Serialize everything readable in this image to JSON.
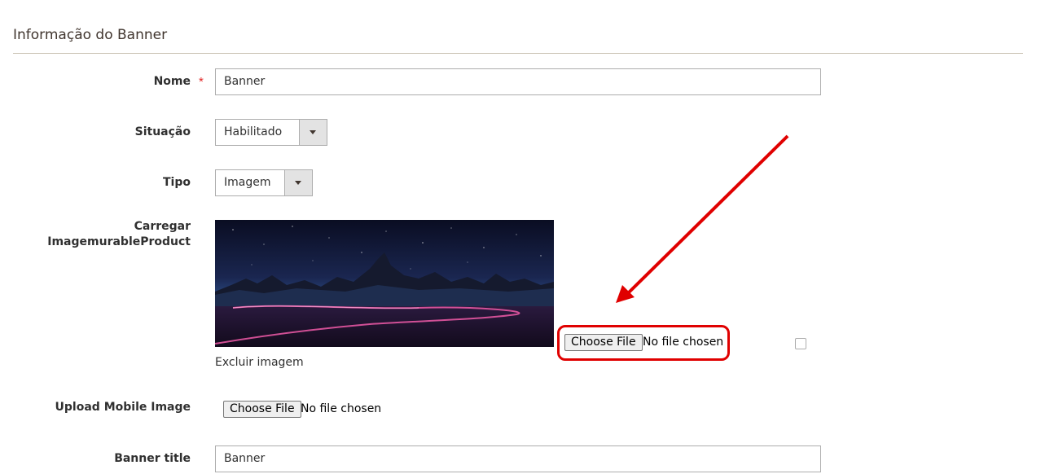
{
  "section": {
    "title": "Informação do Banner"
  },
  "fields": {
    "nome": {
      "label": "Nome",
      "required_mark": "*",
      "value": "Banner"
    },
    "situacao": {
      "label": "Situação",
      "selected": "Habilitado"
    },
    "tipo": {
      "label": "Tipo",
      "selected": "Imagem"
    },
    "carregar": {
      "label_line1": "Carregar",
      "label_line2": "ImagemurableProduct",
      "file_button": "Choose File",
      "file_status": "No file chosen",
      "delete_label": "Excluir imagem",
      "delete_checked": false
    },
    "mobile": {
      "label": "Upload Mobile Image",
      "file_button": "Choose File",
      "file_status": "No file chosen"
    },
    "banner_title": {
      "label": "Banner title",
      "value": "Banner"
    }
  },
  "colors": {
    "annotation": "#e00000",
    "required": "#e22626"
  }
}
